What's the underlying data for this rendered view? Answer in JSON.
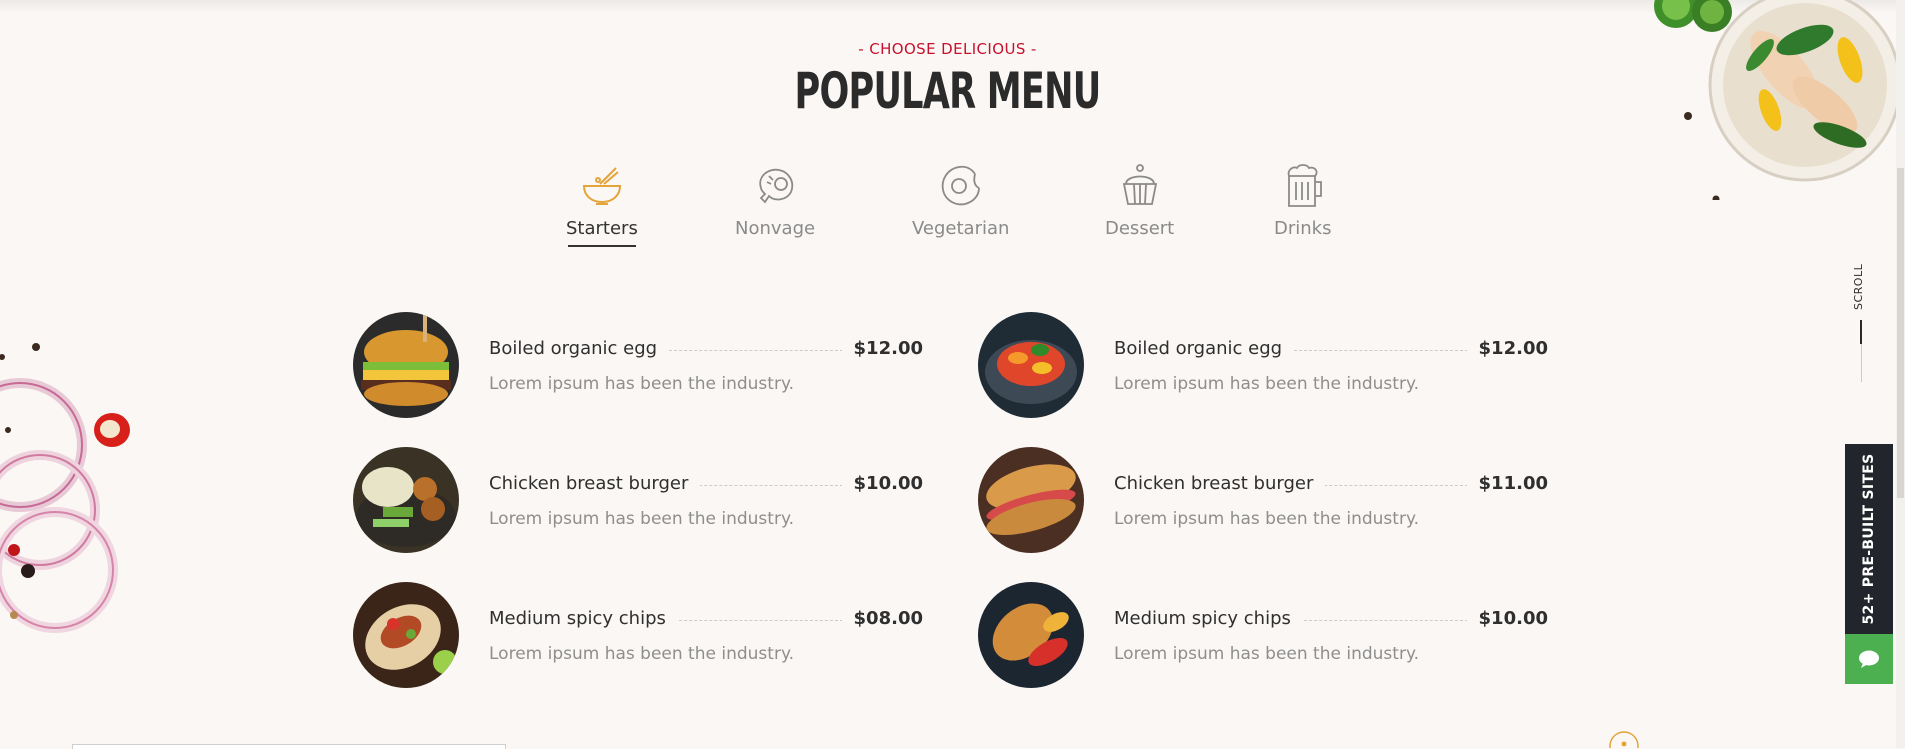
{
  "section": {
    "subtitle": "- CHOOSE DELICIOUS -",
    "title": "POPULAR MENU"
  },
  "tabs": [
    {
      "label": "Starters",
      "icon": "bowl-icon",
      "active": true
    },
    {
      "label": "Nonvage",
      "icon": "meat-icon",
      "active": false
    },
    {
      "label": "Vegetarian",
      "icon": "cabbage-icon",
      "active": false
    },
    {
      "label": "Dessert",
      "icon": "cupcake-icon",
      "active": false
    },
    {
      "label": "Drinks",
      "icon": "beer-mug-icon",
      "active": false
    }
  ],
  "menu_left": [
    {
      "name": "Boiled organic egg",
      "price": "$12.00",
      "desc": "Lorem ipsum has been the industry."
    },
    {
      "name": "Chicken breast burger",
      "price": "$10.00",
      "desc": "Lorem ipsum has been the industry."
    },
    {
      "name": "Medium spicy chips",
      "price": "$08.00",
      "desc": "Lorem ipsum has been the industry."
    }
  ],
  "menu_right": [
    {
      "name": "Boiled organic egg",
      "price": "$12.00",
      "desc": "Lorem ipsum has been the industry."
    },
    {
      "name": "Chicken breast burger",
      "price": "$11.00",
      "desc": "Lorem ipsum has been the industry."
    },
    {
      "name": "Medium spicy chips",
      "price": "$10.00",
      "desc": "Lorem ipsum has been the industry."
    }
  ],
  "side": {
    "scroll_label": "SCROLL",
    "prebuilt_label": "52+ PRE-BUILT SITES"
  },
  "colors": {
    "accent_red": "#c8102e",
    "icon_active": "#e3a43a",
    "background": "#faf7f4",
    "chat_green": "#4caf50"
  }
}
